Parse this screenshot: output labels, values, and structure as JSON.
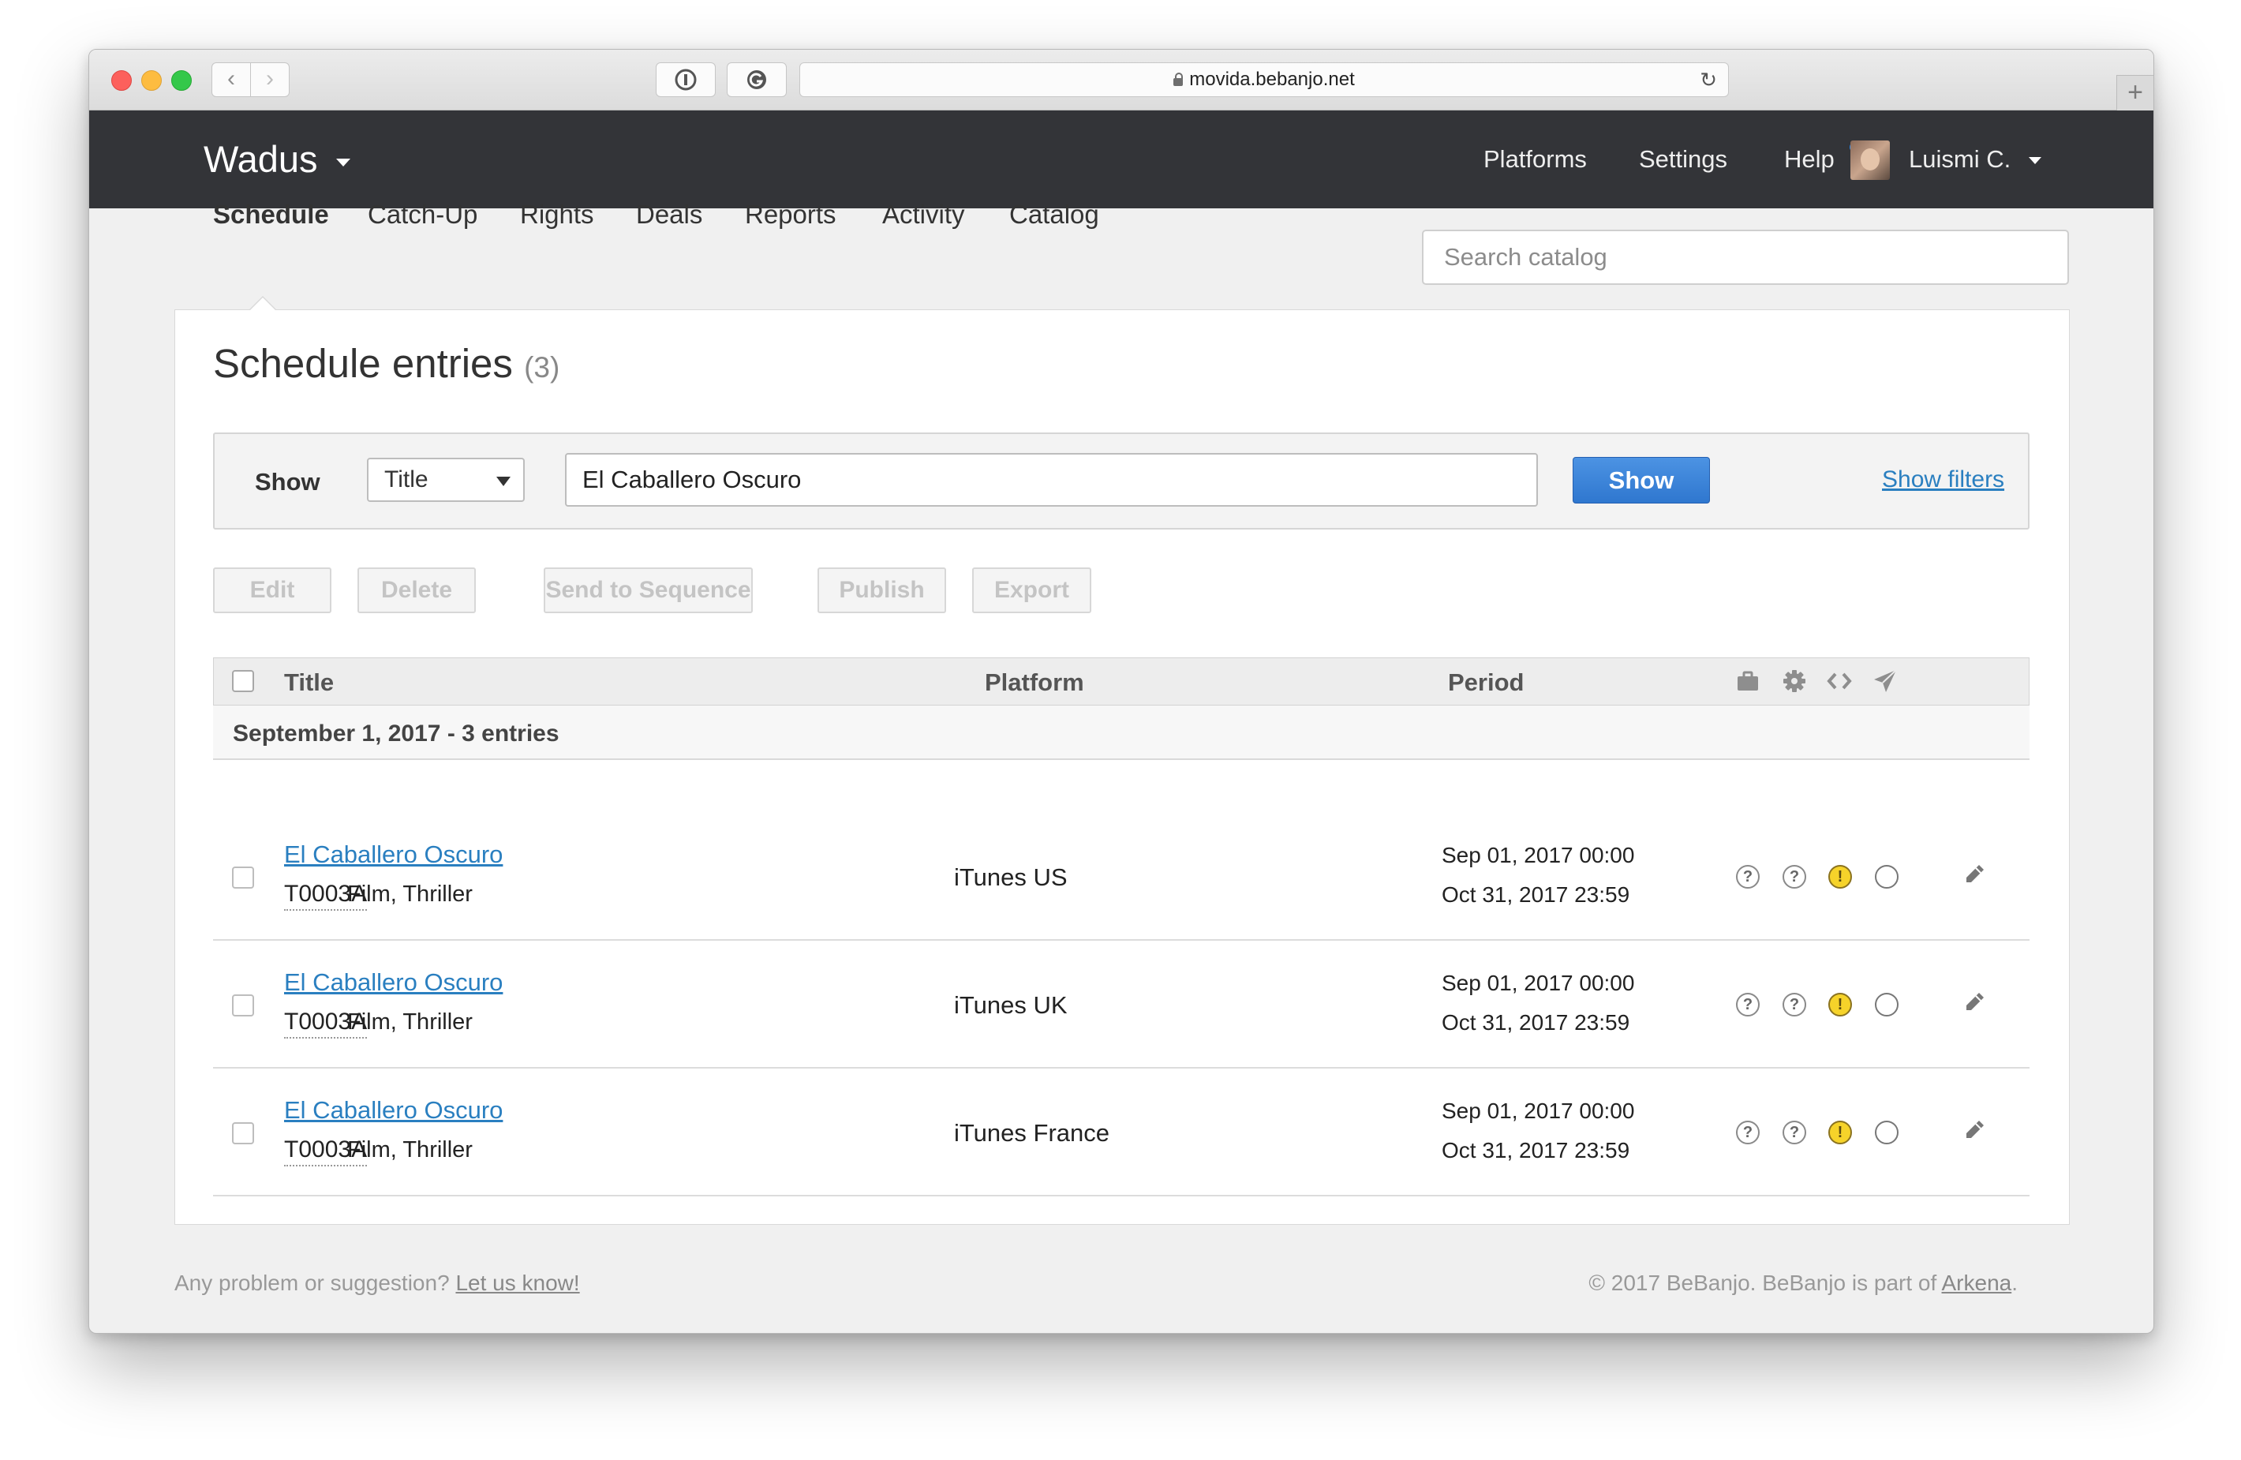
{
  "browser": {
    "url": "movida.bebanjo.net"
  },
  "header": {
    "brand": "Wadus",
    "nav": {
      "platforms": "Platforms",
      "settings": "Settings",
      "help": "Help",
      "user": "Luismi C."
    }
  },
  "subnav": {
    "items": [
      "Schedule",
      "Catch-Up",
      "Rights",
      "Deals",
      "Reports",
      "Activity",
      "Catalog"
    ],
    "active": "Schedule",
    "search_placeholder": "Search catalog"
  },
  "page": {
    "title": "Schedule entries",
    "count": "(3)"
  },
  "filter": {
    "label": "Show",
    "field": "Title",
    "value": "El Caballero Oscuro",
    "button": "Show",
    "show_filters": "Show filters"
  },
  "actions": [
    "Edit",
    "Delete",
    "Send to Sequence",
    "Publish",
    "Export"
  ],
  "table": {
    "columns": {
      "title": "Title",
      "platform": "Platform",
      "period": "Period"
    },
    "header_icons": [
      "briefcase-icon",
      "gear-icon",
      "code-icon",
      "send-icon"
    ],
    "group": "September 1, 2017 - 3 entries",
    "rows": [
      {
        "title": "El Caballero Oscuro",
        "code": "T0003A",
        "genre": "Film, Thriller",
        "platform": "iTunes US",
        "start": "Sep 01, 2017 00:00",
        "end": "Oct 31, 2017 23:59",
        "statuses": [
          "question-icon",
          "question-icon",
          "warning-icon",
          "empty-circle-icon"
        ]
      },
      {
        "title": "El Caballero Oscuro",
        "code": "T0003A",
        "genre": "Film, Thriller",
        "platform": "iTunes UK",
        "start": "Sep 01, 2017 00:00",
        "end": "Oct 31, 2017 23:59",
        "statuses": [
          "question-icon",
          "question-icon",
          "warning-icon",
          "empty-circle-icon"
        ]
      },
      {
        "title": "El Caballero Oscuro",
        "code": "T0003A",
        "genre": "Film, Thriller",
        "platform": "iTunes France",
        "start": "Sep 01, 2017 00:00",
        "end": "Oct 31, 2017 23:59",
        "statuses": [
          "question-icon",
          "question-icon",
          "warning-icon",
          "empty-circle-icon"
        ]
      }
    ]
  },
  "footer": {
    "left_text": "Any problem or suggestion?",
    "left_link": "Let us know!",
    "right_text": "© 2017 BeBanjo. BeBanjo is part of",
    "right_link": "Arkena",
    "right_end": "."
  },
  "colors": {
    "header_bg": "#333438",
    "primary_button": "#3683d9",
    "link": "#2a7fc0",
    "warning": "#f6d32a"
  }
}
